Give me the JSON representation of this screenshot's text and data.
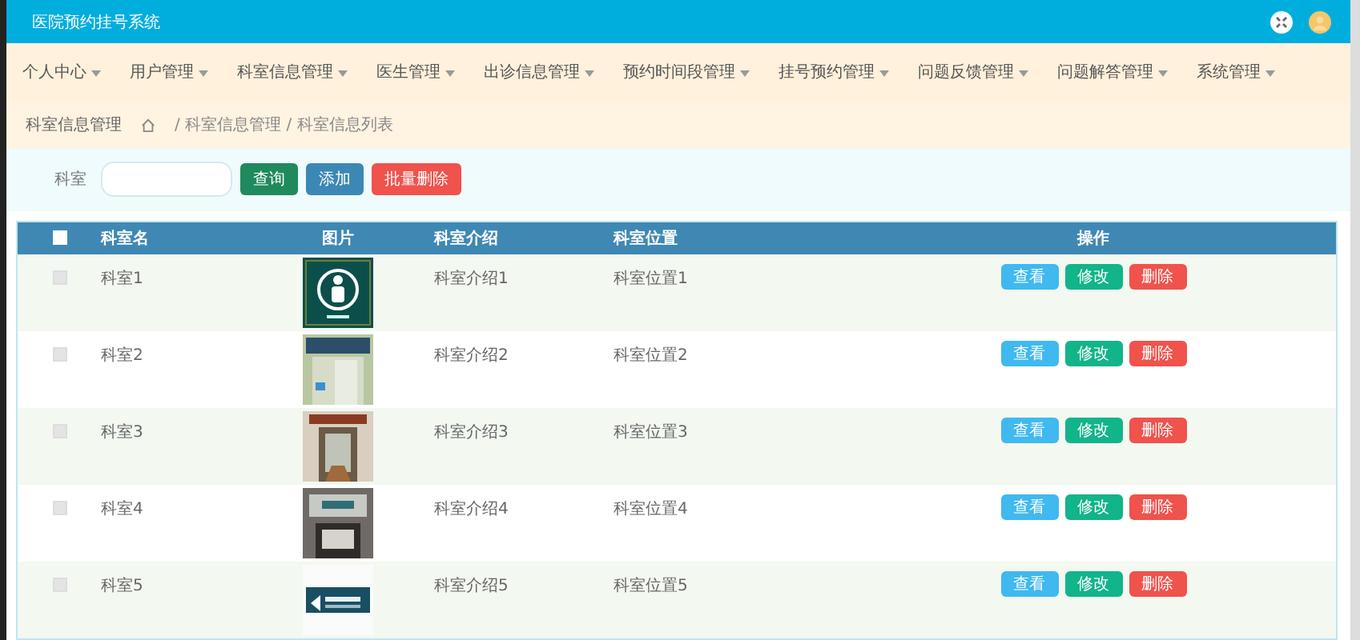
{
  "header": {
    "title": "医院预约挂号系统"
  },
  "menu": [
    {
      "label": "个人中心"
    },
    {
      "label": "用户管理"
    },
    {
      "label": "科室信息管理"
    },
    {
      "label": "医生管理"
    },
    {
      "label": "出诊信息管理"
    },
    {
      "label": "预约时间段管理"
    },
    {
      "label": "挂号预约管理"
    },
    {
      "label": "问题反馈管理"
    },
    {
      "label": "问题解答管理"
    },
    {
      "label": "系统管理"
    }
  ],
  "breadcrumb": {
    "title": "科室信息管理",
    "trail": "/ 科室信息管理 / 科室信息列表"
  },
  "search": {
    "label": "科室",
    "buttons": [
      {
        "label": "查询",
        "kind": "search"
      },
      {
        "label": "添加",
        "kind": "add"
      },
      {
        "label": "批量删除",
        "kind": "delete"
      }
    ]
  },
  "table": {
    "select_all": {
      "checked": false
    },
    "columns": [
      "科室名",
      "图片",
      "科室介绍",
      "科室位置",
      "操作"
    ],
    "rows": [
      {
        "checked": false,
        "name": "科室1",
        "intro": "科室介绍1",
        "location": "科室位置1",
        "actions": [
          {
            "label": "查看",
            "kind": "view"
          },
          {
            "label": "修改",
            "kind": "edit"
          },
          {
            "label": "删除",
            "kind": "delete"
          }
        ]
      },
      {
        "checked": false,
        "name": "科室2",
        "intro": "科室介绍2",
        "location": "科室位置2",
        "actions": [
          {
            "label": "查看",
            "kind": "view"
          },
          {
            "label": "修改",
            "kind": "edit"
          },
          {
            "label": "删除",
            "kind": "delete"
          }
        ]
      },
      {
        "checked": false,
        "name": "科室3",
        "intro": "科室介绍3",
        "location": "科室位置3",
        "actions": [
          {
            "label": "查看",
            "kind": "view"
          },
          {
            "label": "修改",
            "kind": "edit"
          },
          {
            "label": "删除",
            "kind": "delete"
          }
        ]
      },
      {
        "checked": false,
        "name": "科室4",
        "intro": "科室介绍4",
        "location": "科室位置4",
        "actions": [
          {
            "label": "查看",
            "kind": "view"
          },
          {
            "label": "修改",
            "kind": "edit"
          },
          {
            "label": "删除",
            "kind": "delete"
          }
        ]
      },
      {
        "checked": false,
        "name": "科室5",
        "intro": "科室介绍5",
        "location": "科室位置5",
        "actions": [
          {
            "label": "查看",
            "kind": "view"
          },
          {
            "label": "修改",
            "kind": "edit"
          },
          {
            "label": "删除",
            "kind": "delete"
          }
        ]
      }
    ]
  }
}
